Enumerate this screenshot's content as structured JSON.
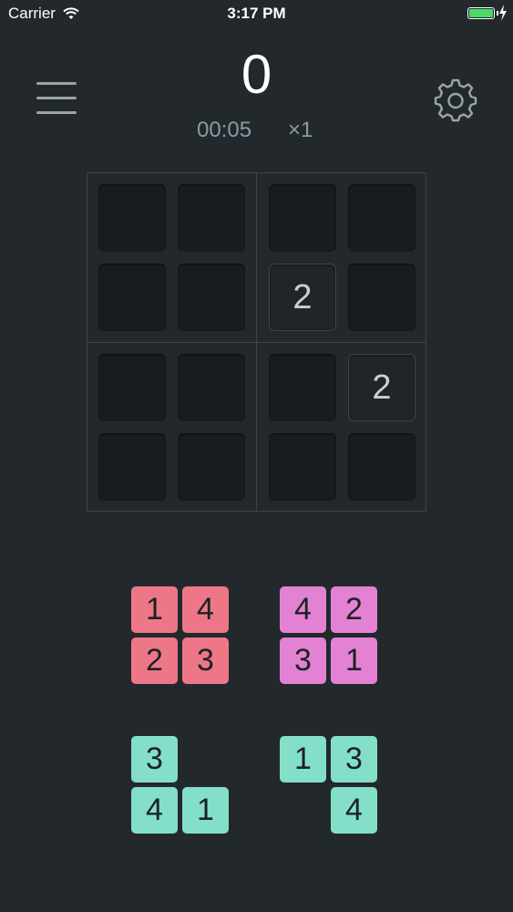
{
  "status_bar": {
    "carrier": "Carrier",
    "time": "3:17 PM"
  },
  "header": {
    "score": "0",
    "timer": "00:05",
    "multiplier": "×1"
  },
  "board": {
    "cells": [
      {
        "row": 0,
        "col": 0,
        "value": ""
      },
      {
        "row": 0,
        "col": 1,
        "value": ""
      },
      {
        "row": 0,
        "col": 2,
        "value": ""
      },
      {
        "row": 0,
        "col": 3,
        "value": ""
      },
      {
        "row": 1,
        "col": 0,
        "value": ""
      },
      {
        "row": 1,
        "col": 1,
        "value": ""
      },
      {
        "row": 1,
        "col": 2,
        "value": "2"
      },
      {
        "row": 1,
        "col": 3,
        "value": ""
      },
      {
        "row": 2,
        "col": 0,
        "value": ""
      },
      {
        "row": 2,
        "col": 1,
        "value": ""
      },
      {
        "row": 2,
        "col": 2,
        "value": ""
      },
      {
        "row": 2,
        "col": 3,
        "value": "2"
      },
      {
        "row": 3,
        "col": 0,
        "value": ""
      },
      {
        "row": 3,
        "col": 1,
        "value": ""
      },
      {
        "row": 3,
        "col": 2,
        "value": ""
      },
      {
        "row": 3,
        "col": 3,
        "value": ""
      }
    ]
  },
  "pieces": [
    {
      "color": "#ee7787",
      "tiles": [
        {
          "row": 0,
          "col": 0,
          "value": "1"
        },
        {
          "row": 0,
          "col": 1,
          "value": "4"
        },
        {
          "row": 1,
          "col": 0,
          "value": "2"
        },
        {
          "row": 1,
          "col": 1,
          "value": "3"
        }
      ]
    },
    {
      "color": "#e382d3",
      "tiles": [
        {
          "row": 0,
          "col": 0,
          "value": "4"
        },
        {
          "row": 0,
          "col": 1,
          "value": "2"
        },
        {
          "row": 1,
          "col": 0,
          "value": "3"
        },
        {
          "row": 1,
          "col": 1,
          "value": "1"
        }
      ]
    },
    {
      "color": "#84dfc8",
      "tiles": [
        {
          "row": 0,
          "col": 0,
          "value": "3"
        },
        {
          "row": 1,
          "col": 0,
          "value": "4"
        },
        {
          "row": 1,
          "col": 1,
          "value": "1"
        }
      ]
    },
    {
      "color": "#84dfc8",
      "tiles": [
        {
          "row": 0,
          "col": 0,
          "value": "1"
        },
        {
          "row": 0,
          "col": 1,
          "value": "3"
        },
        {
          "row": 1,
          "col": 1,
          "value": "4"
        }
      ]
    }
  ],
  "icons": {
    "menu": "hamburger-menu-icon",
    "settings": "gear-icon",
    "wifi": "wifi-icon",
    "battery": "battery-icon",
    "charging": "lightning-bolt-icon"
  }
}
